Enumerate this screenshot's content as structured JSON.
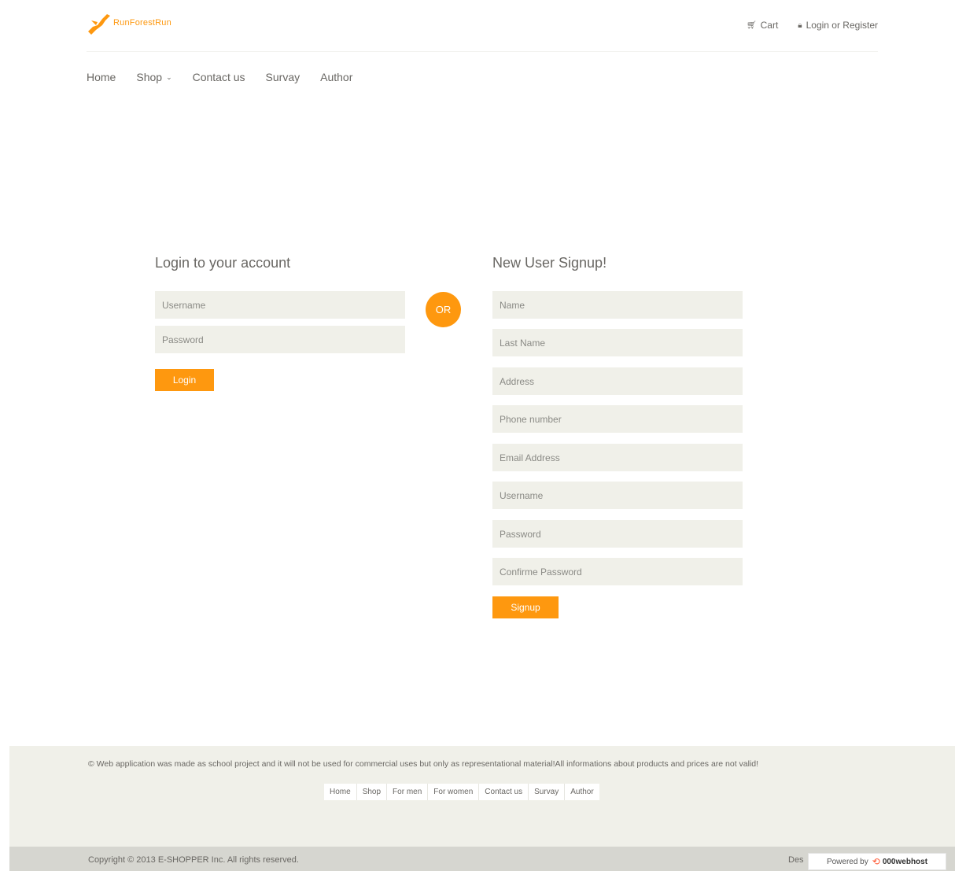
{
  "header": {
    "logo_text": "RunForestRun",
    "cart_label": "Cart",
    "login_label": "Login or Register",
    "cart_icon": "cart-icon",
    "lock_icon": "lock-icon"
  },
  "nav": {
    "home": "Home",
    "shop": "Shop",
    "contact": "Contact us",
    "survey": "Survay",
    "author": "Author"
  },
  "login": {
    "title": "Login to your account",
    "username_placeholder": "Username",
    "password_placeholder": "Password",
    "button": "Login"
  },
  "or_label": "OR",
  "signup": {
    "title": "New User Signup!",
    "name_placeholder": "Name",
    "lastname_placeholder": "Last Name",
    "address_placeholder": "Address",
    "phone_placeholder": "Phone number",
    "email_placeholder": "Email Address",
    "username_placeholder": "Username",
    "password_placeholder": "Password",
    "confirm_placeholder": "Confirme Password",
    "button": "Signup"
  },
  "footer": {
    "note": "© Web application was made as school project and it will not be used for commercial uses but only as representational material!All informations about products and prices are not valid!",
    "links": [
      "Home",
      "Shop",
      "For men",
      "For women",
      "Contact us",
      "Survay",
      "Author"
    ],
    "copyright": "Copyright © 2013 E-SHOPPER Inc. All rights reserved.",
    "design_text": "Des",
    "powered_label": "Powered by",
    "powered_brand": "000webhost"
  },
  "colors": {
    "accent": "#FE980F",
    "input_bg": "#F0F0E9",
    "footer_bg": "#F0F0E9",
    "footer_bottom_bg": "#D6D6D0",
    "text": "#696763"
  }
}
